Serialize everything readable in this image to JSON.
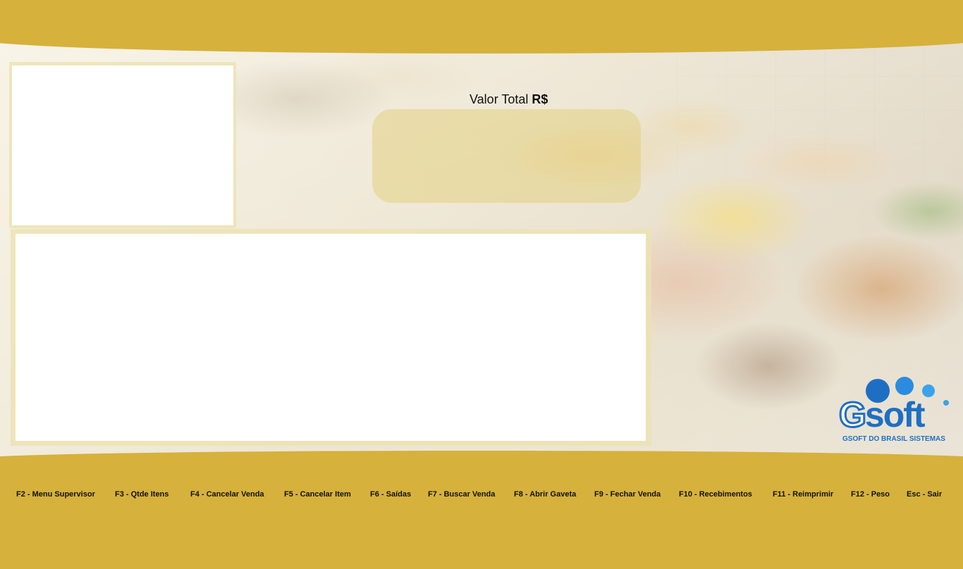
{
  "total": {
    "label_prefix": "Valor Total ",
    "label_currency": "R$",
    "value": ""
  },
  "logo": {
    "brand": "soft",
    "brand_g": "G",
    "tagline": "GSOFT DO BRASIL SISTEMAS",
    "colors": {
      "dark": "#1e6fc4",
      "mid": "#2a8be0",
      "light": "#3aa3ea"
    }
  },
  "function_keys": [
    {
      "label": "F2 - Menu Supervisor"
    },
    {
      "label": "F3 - Qtde Itens"
    },
    {
      "label": "F4 - Cancelar Venda"
    },
    {
      "label": "F5 - Cancelar Item"
    },
    {
      "label": "F6 - Saídas"
    },
    {
      "label": "F7 - Buscar Venda"
    },
    {
      "label": "F8 - Abrir Gaveta"
    },
    {
      "label": "F9 - Fechar Venda"
    },
    {
      "label": "F10 - Recebimentos"
    },
    {
      "label": "F11 - Reimprimir"
    },
    {
      "label": "F12 - Peso"
    },
    {
      "label": "Esc - Sair"
    }
  ],
  "theme": {
    "band": "#d6b13c",
    "panel": "#ffffff"
  }
}
